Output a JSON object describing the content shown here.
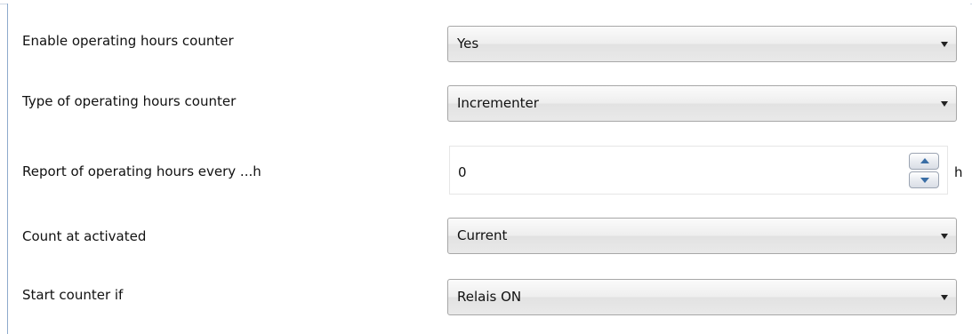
{
  "parameters": [
    {
      "label": "Enable operating hours counter",
      "value": "Yes"
    },
    {
      "label": "Type of operating hours counter",
      "value": "Incrementer"
    },
    {
      "label": "Report of operating hours every ...h",
      "value": "0",
      "unit": "h"
    },
    {
      "label": "Count at activated",
      "value": "Current"
    },
    {
      "label": "Start counter if",
      "value": "Relais ON"
    }
  ],
  "icons": {
    "dropdown": "chevron-down-icon",
    "spin_up": "arrow-up-icon",
    "spin_down": "arrow-down-icon"
  },
  "colors": {
    "panel_border": "#8eaacc",
    "combo_border": "#a7a7a7",
    "spin_arrow": "#3a6ea5"
  }
}
